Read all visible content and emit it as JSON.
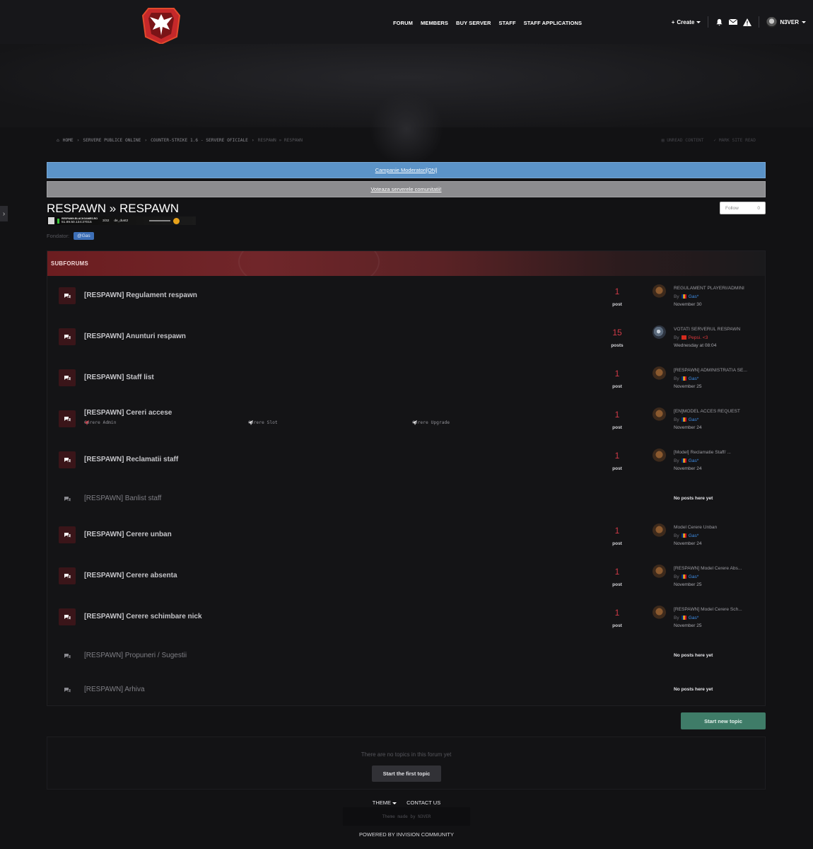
{
  "nav": {
    "items": [
      "FORUM",
      "MEMBERS",
      "BUY SERVER",
      "STAFF",
      "STAFF APPLICATIONS"
    ],
    "create_label": "Create",
    "username": "N3VER"
  },
  "breadcrumb": {
    "items": [
      "HOME",
      "SERVERE PUBLICE ONLINE",
      "COUNTER-STRIKE 1.6 - SERVERE OFICIALE",
      "RESPAWN » RESPAWN"
    ],
    "unread": "UNREAD CONTENT",
    "mark_read": "MARK SITE READ"
  },
  "banners": {
    "first": "Campanie Moderatori[ON]",
    "second": "Voteaza serverele comunitatii!"
  },
  "page": {
    "title": "RESPAWN » RESPAWN",
    "follow_label": "Follow",
    "follow_count": "0",
    "fondator_label": "Fondator:",
    "fondator_badge": "@Gas"
  },
  "server_banner": {
    "host": "RESPAWN.BLACKGAMES.RO",
    "ip": "51.89.50.134:27015",
    "players": "3/32",
    "map": "de_dust2"
  },
  "subforums": {
    "header": "SUBFORUMS",
    "rows": [
      {
        "title": "[RESPAWN] Regulament respawn",
        "count": "1",
        "count_label": "post",
        "last_topic": "REGULAMENT PLAYERI/ADMINI",
        "by": "By",
        "user": "Gas*",
        "date": "November 30"
      },
      {
        "title": "[RESPAWN] Anunturi respawn",
        "count": "15",
        "count_label": "posts",
        "last_topic": "VOTATI SERVERUL RESPAWN",
        "by": "By",
        "user": "Pepsi. <3",
        "date": "Wednesday at 08:04"
      },
      {
        "title": "[RESPAWN] Staff list",
        "count": "1",
        "count_label": "post",
        "last_topic": "[RESPAWN] ADMINISTRATIA SE...",
        "by": "By",
        "user": "Gas*",
        "date": "November 25"
      },
      {
        "title": "[RESPAWN] Cereri accese",
        "count": "1",
        "count_label": "post",
        "last_topic": "[EN]MODEL ACCES REQUEST",
        "by": "By",
        "user": "Gas*",
        "date": "November 24",
        "sublinks": [
          "Cerere Admin",
          "Cerere Slot",
          "Cerere Upgrade"
        ]
      },
      {
        "title": "[RESPAWN] Reclamatii staff",
        "count": "1",
        "count_label": "post",
        "last_topic": "[Model] Reclamatie Staff/ ...",
        "by": "By",
        "user": "Gas*",
        "date": "November 24"
      },
      {
        "title": "[RESPAWN] Banlist staff",
        "no_posts": "No posts here yet"
      },
      {
        "title": "[RESPAWN] Cerere unban",
        "count": "1",
        "count_label": "post",
        "last_topic": "Model Cerere Unban",
        "by": "By",
        "user": "Gas*",
        "date": "November 24"
      },
      {
        "title": "[RESPAWN] Cerere absenta",
        "count": "1",
        "count_label": "post",
        "last_topic": "[RESPAWN] Model Cerere Abs...",
        "by": "By",
        "user": "Gas*",
        "date": "November 25"
      },
      {
        "title": "[RESPAWN] Cerere schimbare nick",
        "count": "1",
        "count_label": "post",
        "last_topic": "[RESPAWN] Model Cerere Sch...",
        "by": "By",
        "user": "Gas*",
        "date": "November 25"
      },
      {
        "title": "[RESPAWN] Propuneri / Sugestii",
        "no_posts": "No posts here yet"
      },
      {
        "title": "[RESPAWN] Arhiva",
        "no_posts": "No posts here yet"
      }
    ]
  },
  "actions": {
    "start_new_topic": "Start new topic",
    "empty_message": "There are no topics in this forum yet",
    "start_first_topic": "Start the first topic"
  },
  "footer": {
    "theme": "THEME",
    "contact": "CONTACT US",
    "theme_made": "Theme made by N3VER",
    "powered": "POWERED BY INVISION COMMUNITY"
  },
  "colors": {
    "accent_red": "#d03a47",
    "banner_blue": "#5b93c8",
    "banner_gray": "#8c8c8f",
    "start_green": "#3f7c68",
    "user_blue": "#3e8ee8"
  }
}
